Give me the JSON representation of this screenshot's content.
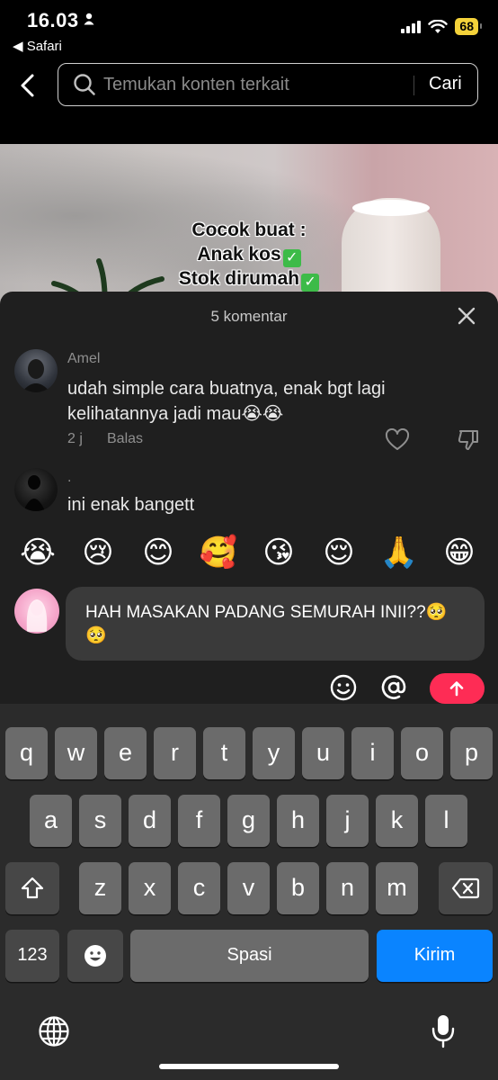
{
  "status_bar": {
    "time": "16.03",
    "back_app": "◀ Safari",
    "battery": "68"
  },
  "search": {
    "placeholder": "Temukan konten terkait",
    "button": "Cari"
  },
  "video": {
    "caption_lines": [
      "Cocok buat :",
      "Anak kos",
      "Stok dirumah"
    ]
  },
  "comments_panel": {
    "title": "5 komentar",
    "comments": [
      {
        "user": "Amel",
        "text": "udah simple cara buatnya, enak bgt lagi kelihatannya jadi mau😭😭",
        "time": "2 j",
        "reply": "Balas"
      },
      {
        "user": ".",
        "text": "ini enak bangett"
      }
    ]
  },
  "emoji_bar": [
    "😭",
    "😢",
    "😊",
    "🥰",
    "😘",
    "😌",
    "🙏",
    "😁"
  ],
  "composer": {
    "text": "HAH MASAKAN PADANG SEMURAH INII??🥺🥺"
  },
  "keyboard": {
    "row1": [
      "q",
      "w",
      "e",
      "r",
      "t",
      "y",
      "u",
      "i",
      "o",
      "p"
    ],
    "row2": [
      "a",
      "s",
      "d",
      "f",
      "g",
      "h",
      "j",
      "k",
      "l"
    ],
    "row3": [
      "z",
      "x",
      "c",
      "v",
      "b",
      "n",
      "m"
    ],
    "numbers_key": "123",
    "space_key": "Spasi",
    "send_key": "Kirim"
  },
  "colors": {
    "send_button": "#fe2c55",
    "keyboard_send": "#0a84ff",
    "battery": "#f4d23a"
  }
}
